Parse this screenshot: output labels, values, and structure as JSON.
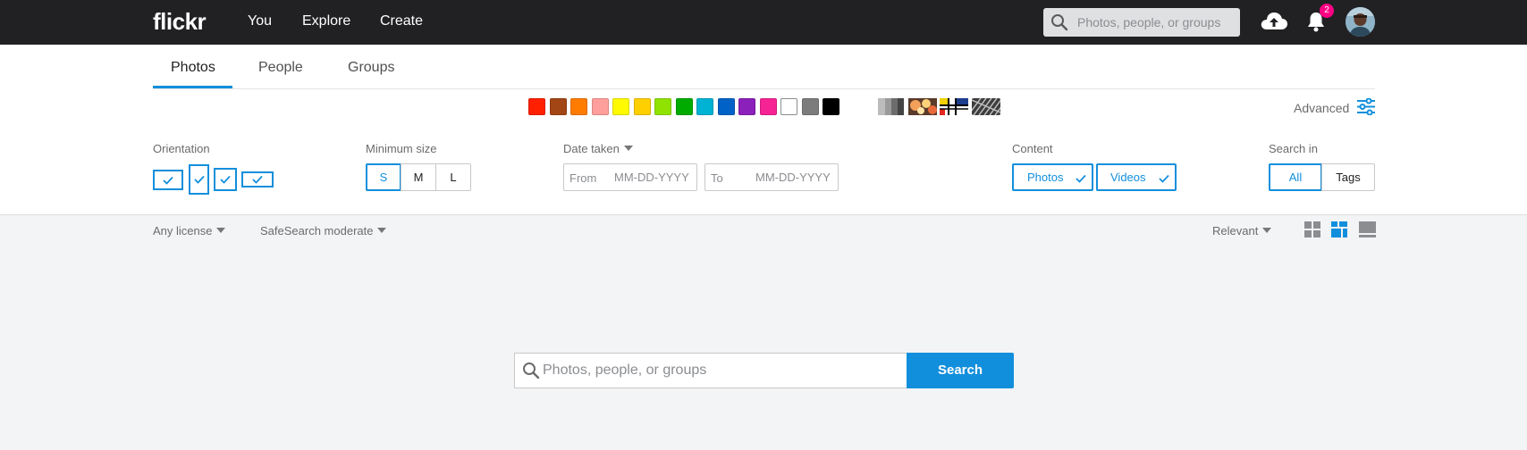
{
  "nav": {
    "logo": "flickr",
    "links": [
      "You",
      "Explore",
      "Create"
    ],
    "search_placeholder": "Photos, people, or groups",
    "notification_count": "2"
  },
  "tabs": [
    "Photos",
    "People",
    "Groups"
  ],
  "colors": [
    "#ff2000",
    "#a24615",
    "#ff7c00",
    "#ff9f9c",
    "#fffa00",
    "#ffcf00",
    "#90e200",
    "#00ab00",
    "#00b2d4",
    "#0062c6",
    "#8c20ba",
    "#f52394",
    "#ffffff",
    "#7c7c7c",
    "#000000"
  ],
  "advanced_label": "Advanced",
  "filters": {
    "orientation_label": "Orientation",
    "min_size_label": "Minimum size",
    "sizes": [
      "S",
      "M",
      "L"
    ],
    "selected_size": "S",
    "date_label": "Date taken",
    "date_from_label": "From",
    "date_to_label": "To",
    "date_placeholder": "MM-DD-YYYY",
    "content_label": "Content",
    "content_photos": "Photos",
    "content_videos": "Videos",
    "search_in_label": "Search in",
    "search_in_all": "All",
    "search_in_tags": "Tags"
  },
  "toolbar": {
    "license": "Any license",
    "safesearch": "SafeSearch moderate",
    "sort": "Relevant"
  },
  "main_search": {
    "placeholder": "Photos, people, or groups",
    "button": "Search"
  },
  "accent": "#128fdc"
}
